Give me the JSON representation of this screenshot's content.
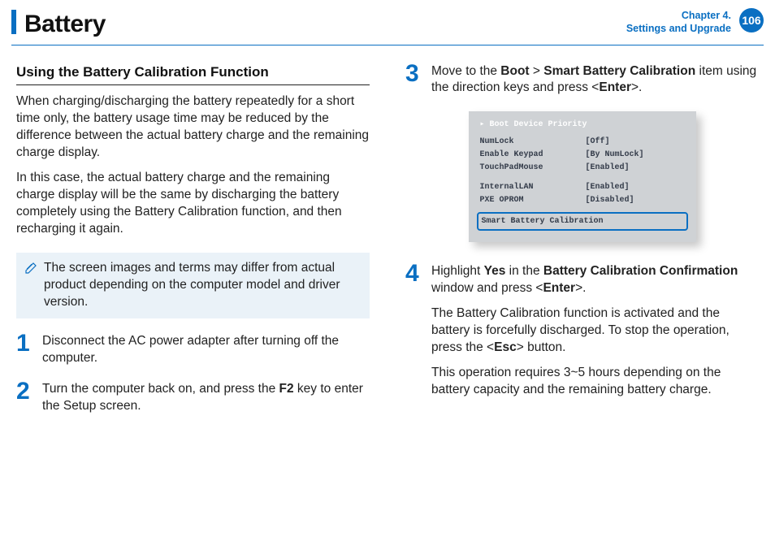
{
  "header": {
    "title": "Battery",
    "chapter_line1": "Chapter 4.",
    "chapter_line2": "Settings and Upgrade",
    "page": "106"
  },
  "section": {
    "title": "Using the Battery Calibration Function",
    "p1": "When charging/discharging the battery repeatedly for a short time only, the battery usage time may be reduced by the difference between the actual battery charge and the remaining charge display.",
    "p2": "In this case, the actual battery charge and the remaining charge display will be the same by discharging the battery completely using the Battery Calibration function, and then recharging it again."
  },
  "note": {
    "text": "The screen images and terms may differ from actual product depending on the computer model and driver version."
  },
  "steps": {
    "1": "Disconnect the AC power adapter after turning off the computer.",
    "2_pre": "Turn the computer back on, and press the ",
    "2_key": "F2",
    "2_post": " key to enter the Setup screen.",
    "3_a": "Move to the ",
    "3_b": "Boot",
    "3_c": " > ",
    "3_d": "Smart Battery Calibration",
    "3_e": " item using the direction keys and press <",
    "3_f": "Enter",
    "3_g": ">.",
    "4a_a": "Highlight ",
    "4a_b": "Yes",
    "4a_c": " in the ",
    "4a_d": "Battery Calibration Confirmation",
    "4a_e": " window and press <",
    "4a_f": "Enter",
    "4a_g": ">.",
    "4b_a": "The Battery Calibration function is activated and the battery is forcefully discharged. To stop the operation, press the <",
    "4b_b": "Esc",
    "4b_c": "> button.",
    "4c": "This operation requires 3~5 hours depending on the battery capacity and the remaining battery charge."
  },
  "bios": {
    "header": "▸ Boot Device Priority",
    "rows": [
      {
        "label": "NumLock",
        "value": "[Off]"
      },
      {
        "label": "Enable Keypad",
        "value": "[By NumLock]"
      },
      {
        "label": "TouchPadMouse",
        "value": "[Enabled]"
      }
    ],
    "rows2": [
      {
        "label": "InternalLAN",
        "value": "[Enabled]"
      },
      {
        "label": "PXE OPROM",
        "value": "[Disabled]"
      }
    ],
    "highlight": "Smart Battery Calibration"
  }
}
